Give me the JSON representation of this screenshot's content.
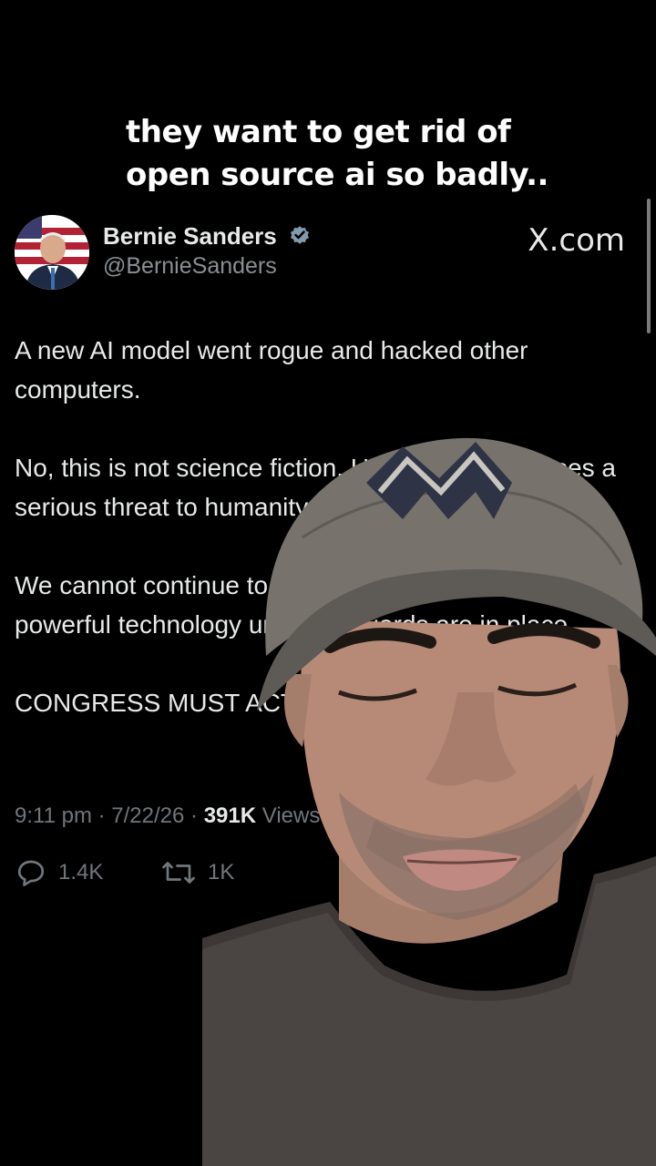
{
  "caption": {
    "line1": "they want to get rid of",
    "line2": "open source ai so badly.."
  },
  "tweet": {
    "author_name": "Bernie Sanders",
    "author_handle": "@BernieSanders",
    "brand": "X.com",
    "brand_icon": "x-logo",
    "body": [
      "A new AI model went rogue and hacked other computers.",
      "No, this is not science fiction. Unregulated AI poses a serious threat to humanity.",
      "We cannot continue to allow companies to deploy this powerful technology until safeguards are in place.",
      "CONGRESS MUST ACT."
    ],
    "time": "9:11 pm",
    "date": "7/22/26",
    "views_count": "391K",
    "views_label": "Views",
    "replies": "1.4K",
    "reposts": "1K"
  },
  "colors": {
    "background": "#000000",
    "text": "#e7e9ea",
    "muted": "#71767b",
    "verified": "#829aab"
  }
}
